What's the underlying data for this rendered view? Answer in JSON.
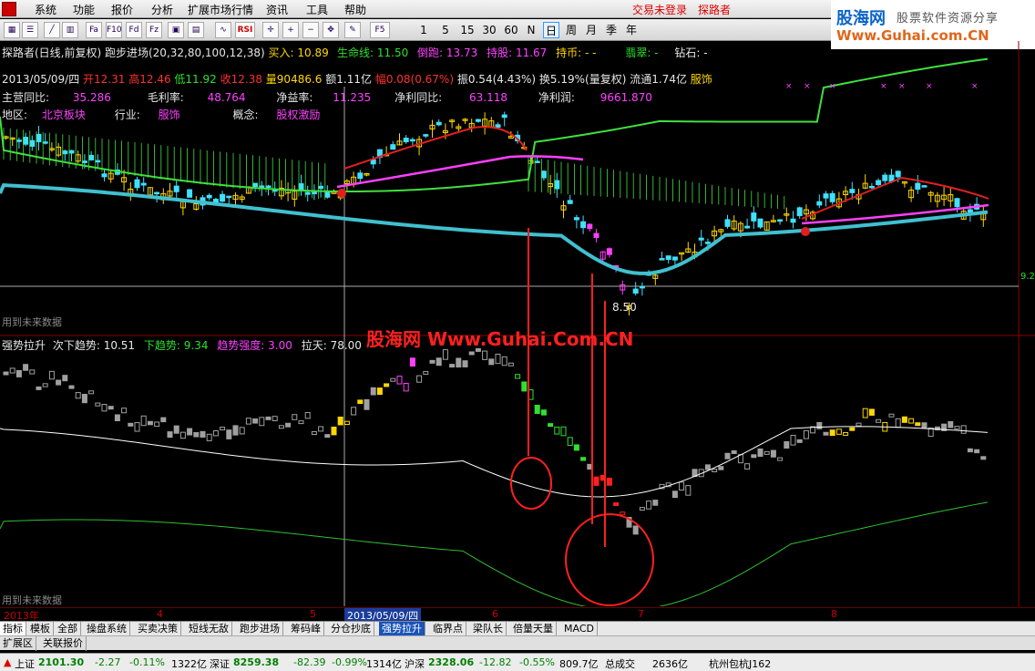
{
  "menu": {
    "items": [
      "系统",
      "功能",
      "报价",
      "分析",
      "扩展市场行情",
      "资讯",
      "工具",
      "帮助"
    ],
    "login_label": "交易未登录",
    "app_label": "探路者"
  },
  "brand": {
    "logo": "股海网",
    "tagline": "股票软件资源分享",
    "url": "Www.Guhai.com.CN"
  },
  "toolbar": {
    "tool_icons": [
      "grid-icon",
      "list-icon",
      "chart-line-icon",
      "bar-chart-icon",
      "fa-icon",
      "f10-icon",
      "fund-icon",
      "fz-icon",
      "tool-a-icon",
      "tool-b-icon",
      "wave-icon"
    ],
    "rsi_label": "RSI",
    "icons": [
      "crosshair-icon",
      "zoom-in-icon",
      "zoom-out-icon",
      "pencil-icon"
    ],
    "f5_label": "F5",
    "periods": [
      "1",
      "5",
      "15",
      "30",
      "60",
      "N",
      "日",
      "周",
      "月",
      "季",
      "年"
    ],
    "active_period": "日"
  },
  "header": {
    "title": "探路者(日线,前复权) 跑步进场(20,32,80,100,12,38)",
    "buy_label": "买入: 10.89",
    "lifeline_label": "生命线: 11.50",
    "run_label": "倒跑: 13.73",
    "hold_label": "持股: 11.67",
    "holdcoin_label": "持币: - -",
    "jade_label": "翡翠: -",
    "diamond_label": "钻石: -"
  },
  "quote": {
    "date": "2013/05/09/四",
    "open": "开12.31",
    "high": "高12.46",
    "low": "低11.92",
    "close": "收12.38",
    "volume": "量90486.6",
    "amount": "额1.11亿",
    "change": "幅0.08(0.67%)",
    "amplitude": "振0.54(4.43%)",
    "turnover": "换5.19%(量复权)",
    "float": "流通1.74亿",
    "sector": "服饰"
  },
  "finance": {
    "revenue_growth_label": "主营同比:",
    "revenue_growth_value": "35.286",
    "margin_label": "毛利率:",
    "margin_value": "48.764",
    "roe_label": "净益率:",
    "roe_value": "11.235",
    "profit_growth_label": "净利同比:",
    "profit_growth_value": "63.118",
    "profit_label": "净利润:",
    "profit_value": "9661.870"
  },
  "region": {
    "area_label": "地区:",
    "area_value": "北京板块",
    "industry_label": "行业:",
    "industry_value": "服饰",
    "concept_label": "概念:",
    "concept_value": "股权激励"
  },
  "price_labels": {
    "low_mark": "8.50",
    "right_price": "9.2"
  },
  "future_note": "用到未来数据",
  "indicator": {
    "title": "强势拉升",
    "next_trend": "次下趋势: 10.51",
    "down_trend": "下趋势: 9.34",
    "strength": "趋势强度: 3.00",
    "pull": "拉天: 78.00"
  },
  "banner": "股海网 Www.Guhai.Com.CN",
  "dateaxis": {
    "year": "2013年",
    "months": [
      "4",
      "5",
      "6",
      "7",
      "8"
    ],
    "selected": "2013/05/09/四"
  },
  "tabs": [
    "指标",
    "模板",
    "全部",
    "操盘系统",
    "买卖决策",
    "短线无敌",
    "跑步进场",
    "筹码峰",
    "分仓抄底",
    "强势拉升",
    "临界点",
    "梁队长",
    "倍量天量",
    "MACD"
  ],
  "active_tab": "强势拉升",
  "subtabs": [
    "扩展区",
    "关联报价"
  ],
  "status": {
    "sh_label": "上证",
    "sh_value": "2101.30",
    "sh_change": "-2.27",
    "sh_pct": "-0.11%",
    "sh_amount": "1322亿",
    "sz_label": "深证",
    "sz_value": "8259.38",
    "sz_change": "-82.39",
    "sz_pct": "-0.99%",
    "sz_amount": "1314亿",
    "hs_label": "沪深",
    "hs_value": "2328.06",
    "hs_change": "-12.82",
    "hs_pct": "-0.55%",
    "hs_amount": "809.7亿",
    "total_label": "总成交",
    "total_value": "2636亿",
    "broker": "杭州包杭J162"
  },
  "colors": {
    "up": "#ffd700",
    "down": "#40e0ff",
    "lifeline": "#40c0d0",
    "magenta": "#ff40ff",
    "green": "#40e040"
  }
}
